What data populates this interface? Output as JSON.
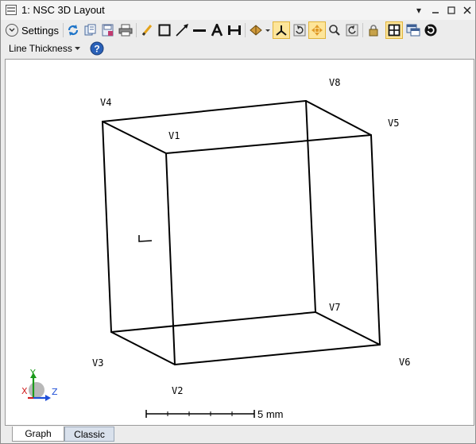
{
  "window": {
    "title": "1: NSC 3D Layout"
  },
  "toolbar": {
    "settings_label": "Settings",
    "line_thickness_label": "Line Thickness",
    "icons": [
      "refresh-icon",
      "copy-icon",
      "save-icon",
      "print-icon",
      "pencil-icon",
      "rectangle-icon",
      "arrow-line-icon",
      "line-icon",
      "text-icon",
      "dimension-icon",
      "rotate-view-icon",
      "axis-icon",
      "rotate-3d-icon",
      "pan-icon",
      "zoom-icon",
      "reset-view-icon",
      "lock-icon",
      "fit-icon",
      "window-icon",
      "refresh-circle-icon",
      "help-icon"
    ]
  },
  "layout": {
    "vertices": [
      {
        "name": "V1"
      },
      {
        "name": "V2"
      },
      {
        "name": "V3"
      },
      {
        "name": "V4"
      },
      {
        "name": "V5"
      },
      {
        "name": "V6"
      },
      {
        "name": "V7"
      },
      {
        "name": "V8"
      }
    ],
    "axes": {
      "x": "X",
      "y": "Y",
      "z": "Z"
    },
    "scale_bar_label": "5 mm"
  },
  "tabs": [
    {
      "label": "Graph",
      "active": true
    },
    {
      "label": "Classic",
      "active": false
    }
  ]
}
